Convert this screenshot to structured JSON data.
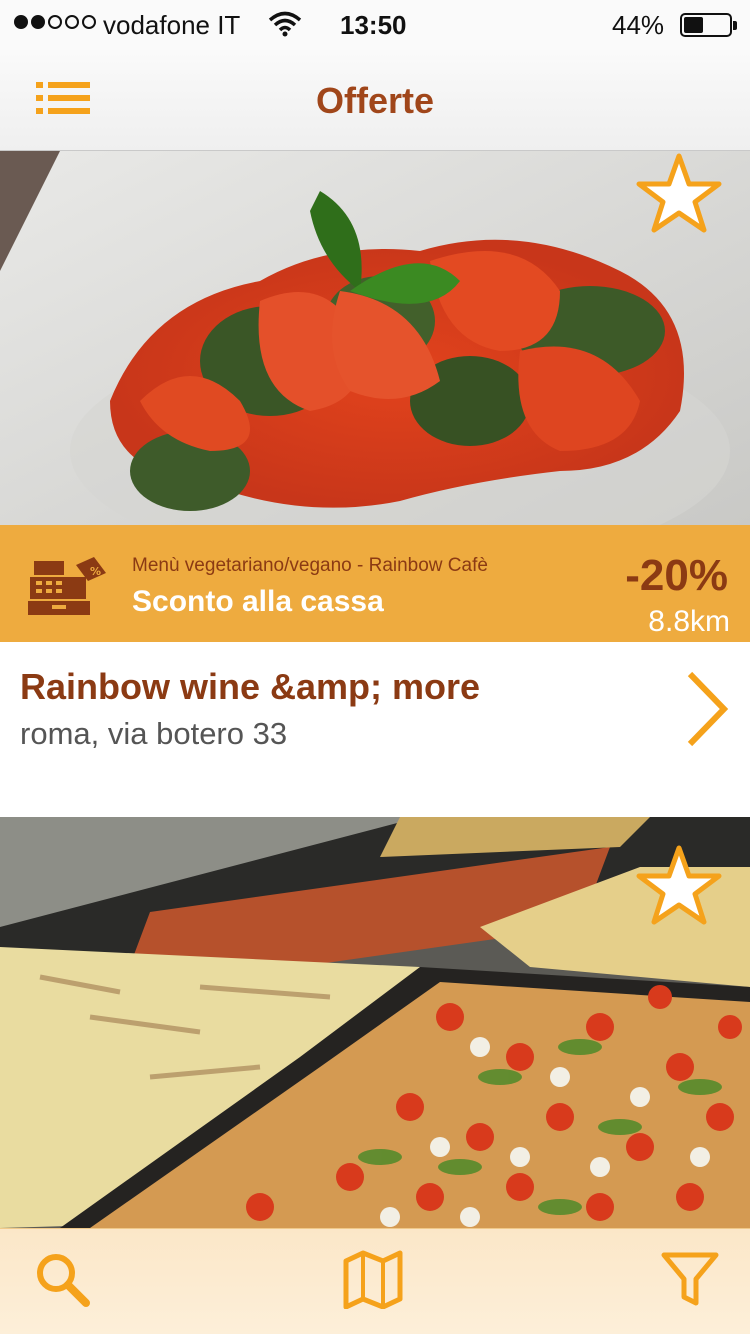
{
  "status_bar": {
    "carrier": "vodafone IT",
    "time": "13:50",
    "battery": "44%",
    "battery_level": 0.44,
    "signal_bars_filled": 2,
    "signal_bars_total": 5
  },
  "nav": {
    "title": "Offerte",
    "menu_icon": "list-icon"
  },
  "colors": {
    "accent": "#f5a21b",
    "brand_brown": "#a0461a",
    "banner": "#eeab3f"
  },
  "offers": [
    {
      "image": "photo of spinach gnocchi with tomato sauce and basil",
      "favorite_icon": "star-icon",
      "promo_icon": "cash-register-icon",
      "offer_name": "Menù vegetariano/vegano - Rainbow Cafè",
      "offer_type": "Sconto alla cassa",
      "discount": "-20%",
      "distance": "8.8km",
      "place_name": "Rainbow wine &amp; more",
      "address": "roma, via botero 33"
    },
    {
      "image": "photo of trays of roman pizza al taglio",
      "favorite_icon": "star-icon"
    }
  ],
  "tab_bar": {
    "tabs": [
      {
        "icon": "search-icon"
      },
      {
        "icon": "map-icon"
      },
      {
        "icon": "filter-icon"
      }
    ]
  }
}
